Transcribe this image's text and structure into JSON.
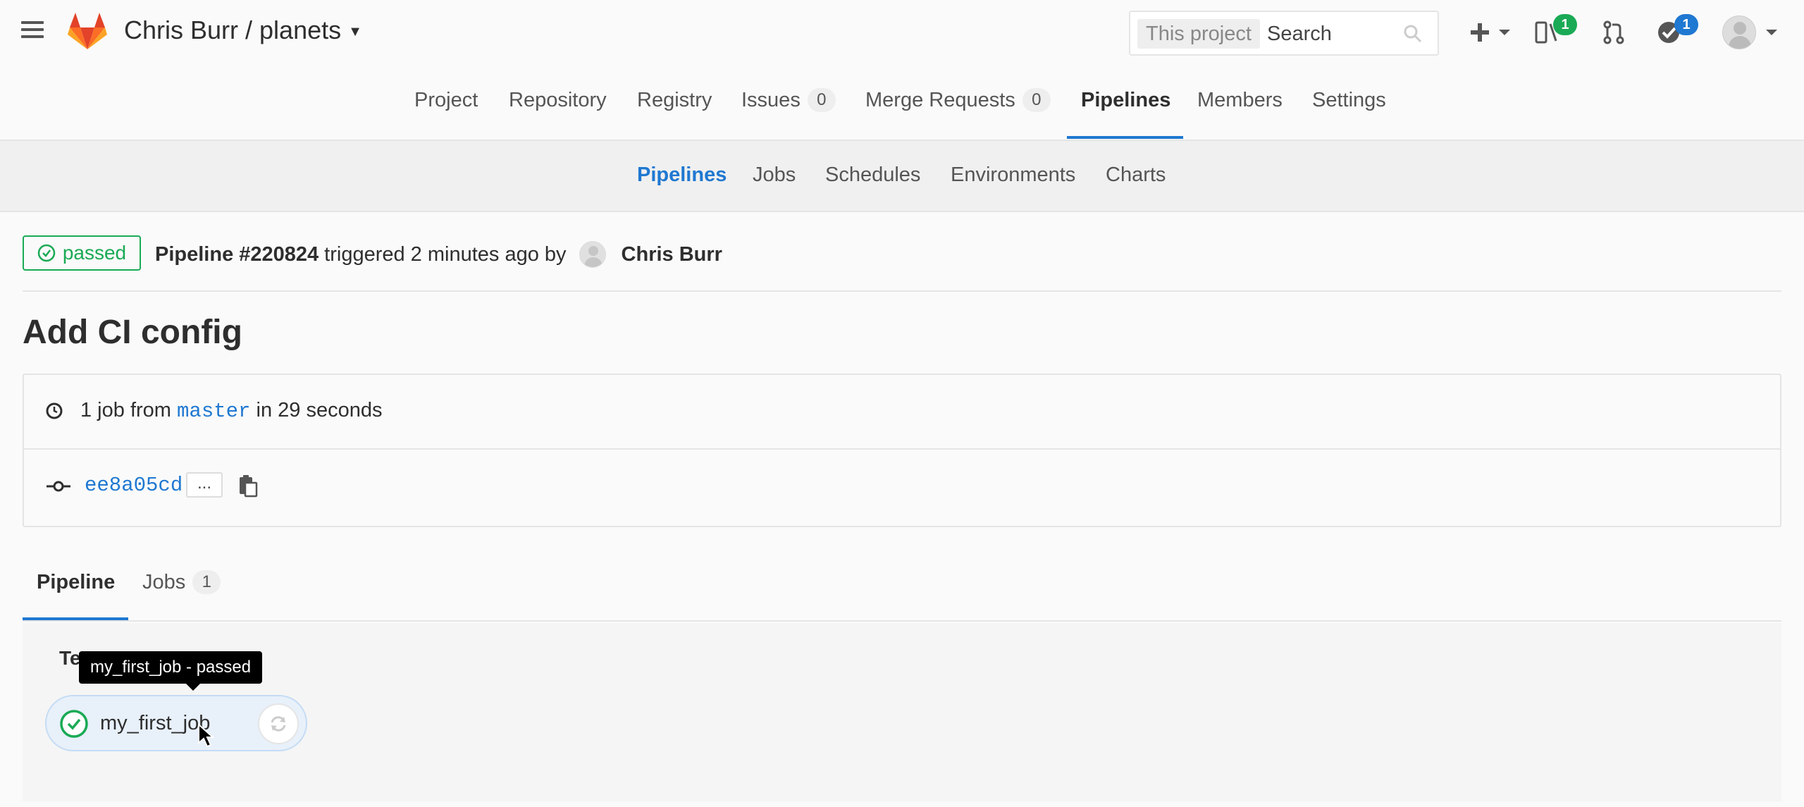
{
  "header": {
    "project_title": "Chris Burr / planets",
    "search": {
      "scope": "This project",
      "placeholder": "Search"
    },
    "todos_badge": "1",
    "notifications_badge": "1"
  },
  "project_nav": {
    "tabs": [
      {
        "label": "Project"
      },
      {
        "label": "Repository"
      },
      {
        "label": "Registry"
      },
      {
        "label": "Issues",
        "count": "0"
      },
      {
        "label": "Merge Requests",
        "count": "0"
      },
      {
        "label": "Pipelines",
        "active": true
      },
      {
        "label": "Members"
      },
      {
        "label": "Settings"
      }
    ]
  },
  "sub_nav": {
    "tabs": [
      {
        "label": "Pipelines",
        "active": true
      },
      {
        "label": "Jobs"
      },
      {
        "label": "Schedules"
      },
      {
        "label": "Environments"
      },
      {
        "label": "Charts"
      }
    ]
  },
  "pipeline": {
    "status": "passed",
    "title": "Pipeline #220824",
    "triggered_text": "triggered 2 minutes ago by",
    "author": "Chris Burr",
    "commit_title": "Add CI config",
    "jobs_summary_prefix": "1 job from",
    "branch": "master",
    "duration_text": "in 29 seconds",
    "sha": "ee8a05cd",
    "ellipsis": "..."
  },
  "tabs": {
    "pipeline": "Pipeline",
    "jobs": "Jobs",
    "jobs_count": "1"
  },
  "graph": {
    "stage_name": "Test",
    "job_name": "my_first_job",
    "tooltip": "my_first_job - passed"
  },
  "colors": {
    "success": "#1aaa55",
    "link": "#1f78d1",
    "brand_orange": "#e24329"
  }
}
